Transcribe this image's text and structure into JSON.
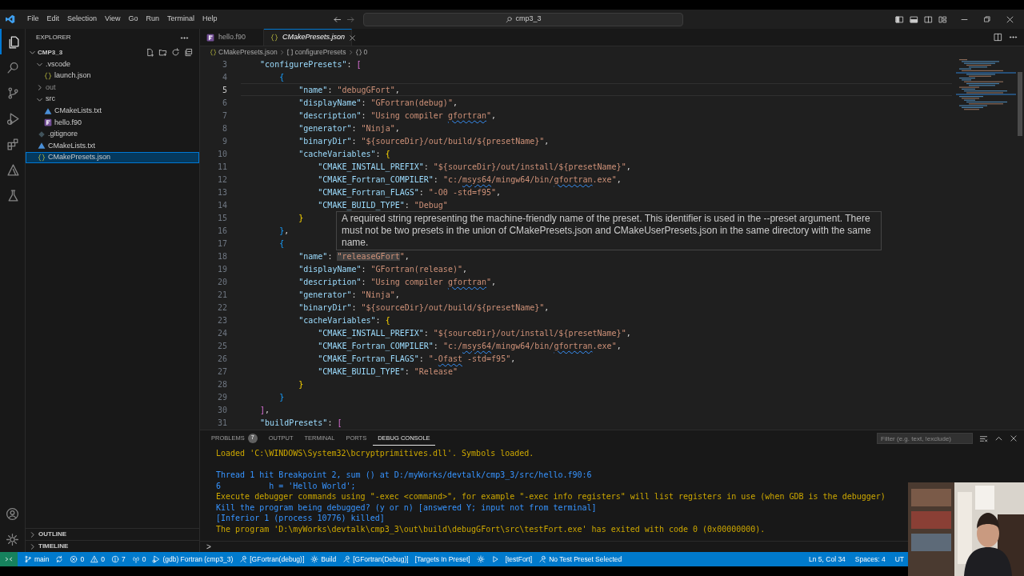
{
  "title_bar": {
    "menu": [
      "File",
      "Edit",
      "Selection",
      "View",
      "Go",
      "Run",
      "Terminal",
      "Help"
    ],
    "command_center": "cmp3_3"
  },
  "activity_bar": [
    {
      "kind": "files",
      "selected": true
    },
    {
      "kind": "search",
      "selected": false
    },
    {
      "kind": "branch",
      "selected": false
    },
    {
      "kind": "rundebug",
      "selected": false
    },
    {
      "kind": "extensions",
      "selected": false
    },
    {
      "kind": "triangle",
      "selected": false
    },
    {
      "kind": "flask",
      "selected": false
    }
  ],
  "activity_bar_bottom": [
    {
      "kind": "account"
    },
    {
      "kind": "gear"
    }
  ],
  "sidebar": {
    "title": "EXPLORER",
    "root": "CMP3_3",
    "tree": [
      {
        "label": ".vscode",
        "kind": "folder",
        "expanded": true,
        "dimmed": false,
        "selected": false,
        "children": [
          {
            "label": "launch.json",
            "kind": "json",
            "dimmed": false,
            "selected": false
          }
        ]
      },
      {
        "label": "out",
        "kind": "folder",
        "expanded": false,
        "dimmed": true,
        "selected": false
      },
      {
        "label": "src",
        "kind": "folder",
        "expanded": true,
        "dimmed": false,
        "selected": false,
        "children": [
          {
            "label": "CMakeLists.txt",
            "kind": "cmake",
            "dimmed": false,
            "selected": false
          },
          {
            "label": "hello.f90",
            "kind": "fortran",
            "dimmed": false,
            "selected": false
          }
        ]
      },
      {
        "label": ".gitignore",
        "kind": "gitignore",
        "dimmed": false,
        "selected": false
      },
      {
        "label": "CMakeLists.txt",
        "kind": "cmake",
        "dimmed": false,
        "selected": false
      },
      {
        "label": "CMakePresets.json",
        "kind": "json",
        "dimmed": false,
        "selected": true
      }
    ],
    "sections": [
      "OUTLINE",
      "TIMELINE"
    ]
  },
  "tabs": [
    {
      "label": "hello.f90",
      "kind": "fortran",
      "selected": false,
      "preview": false
    },
    {
      "label": "CMakePresets.json",
      "kind": "json",
      "selected": true,
      "preview": true
    }
  ],
  "breadcrumb": [
    {
      "kind": "json",
      "text": "CMakePresets.json"
    },
    {
      "kind": "array",
      "text": "configurePresets"
    },
    {
      "kind": "object",
      "text": "0"
    }
  ],
  "code": [
    {
      "number": "3",
      "current": false,
      "tokens": [
        {
          "kind": "key",
          "text": "    \"configurePresets\""
        },
        {
          "kind": "punct",
          "text": ": "
        },
        {
          "kind": "bracket_orchid",
          "text": "["
        }
      ]
    },
    {
      "number": "4",
      "current": false,
      "tokens": [
        {
          "kind": "bracket_blue",
          "text": "        {"
        }
      ]
    },
    {
      "number": "5",
      "current": true,
      "tokens": [
        {
          "kind": "key",
          "text": "            \"name\""
        },
        {
          "kind": "punct",
          "text": ": "
        },
        {
          "kind": "string",
          "text": "\"debugGFort\""
        },
        {
          "kind": "punct",
          "text": ","
        }
      ]
    },
    {
      "number": "6",
      "current": false,
      "tokens": [
        {
          "kind": "key",
          "text": "            \"displayName\""
        },
        {
          "kind": "punct",
          "text": ": "
        },
        {
          "kind": "string",
          "text": "\"GFortran(debug)\""
        },
        {
          "kind": "punct",
          "text": ","
        }
      ]
    },
    {
      "number": "7",
      "current": false,
      "tokens": [
        {
          "kind": "key",
          "text": "            \"description\""
        },
        {
          "kind": "punct",
          "text": ": "
        },
        {
          "kind": "string",
          "text": "\"Using compiler "
        },
        {
          "kind": "squiggle",
          "text": "gfortran"
        },
        {
          "kind": "string",
          "text": "\""
        },
        {
          "kind": "punct",
          "text": ","
        }
      ]
    },
    {
      "number": "8",
      "current": false,
      "tokens": [
        {
          "kind": "key",
          "text": "            \"generator\""
        },
        {
          "kind": "punct",
          "text": ": "
        },
        {
          "kind": "string",
          "text": "\"Ninja\""
        },
        {
          "kind": "punct",
          "text": ","
        }
      ]
    },
    {
      "number": "9",
      "current": false,
      "tokens": [
        {
          "kind": "key",
          "text": "            \"binaryDir\""
        },
        {
          "kind": "punct",
          "text": ": "
        },
        {
          "kind": "string",
          "text": "\"${sourceDir}/out/build/${presetName}\""
        },
        {
          "kind": "punct",
          "text": ","
        }
      ]
    },
    {
      "number": "10",
      "current": false,
      "tokens": [
        {
          "kind": "key",
          "text": "            \"cacheVariables\""
        },
        {
          "kind": "punct",
          "text": ": "
        },
        {
          "kind": "bracket_gold",
          "text": "{"
        }
      ]
    },
    {
      "number": "11",
      "current": false,
      "tokens": [
        {
          "kind": "key",
          "text": "                \"CMAKE_INSTALL_PREFIX\""
        },
        {
          "kind": "punct",
          "text": ": "
        },
        {
          "kind": "string",
          "text": "\"${sourceDir}/out/install/${presetName}\""
        },
        {
          "kind": "punct",
          "text": ","
        }
      ]
    },
    {
      "number": "12",
      "current": false,
      "tokens": [
        {
          "kind": "key",
          "text": "                \"CMAKE_Fortran_COMPILER\""
        },
        {
          "kind": "punct",
          "text": ": "
        },
        {
          "kind": "string",
          "text": "\"c:/"
        },
        {
          "kind": "squiggle",
          "text": "msys64"
        },
        {
          "kind": "string",
          "text": "/mingw64/bin/"
        },
        {
          "kind": "squiggle",
          "text": "gfortran"
        },
        {
          "kind": "string",
          "text": ".exe\""
        },
        {
          "kind": "punct",
          "text": ","
        }
      ]
    },
    {
      "number": "13",
      "current": false,
      "tokens": [
        {
          "kind": "key",
          "text": "                \"CMAKE_Fortran_FLAGS\""
        },
        {
          "kind": "punct",
          "text": ": "
        },
        {
          "kind": "string",
          "text": "\"-O0 -std=f95\""
        },
        {
          "kind": "punct",
          "text": ","
        }
      ]
    },
    {
      "number": "14",
      "current": false,
      "tokens": [
        {
          "kind": "key",
          "text": "                \"CMAKE_BUILD_TYPE\""
        },
        {
          "kind": "punct",
          "text": ": "
        },
        {
          "kind": "string",
          "text": "\"Debug\""
        }
      ]
    },
    {
      "number": "15",
      "current": false,
      "tokens": [
        {
          "kind": "bracket_gold",
          "text": "            }"
        }
      ]
    },
    {
      "number": "16",
      "current": false,
      "tokens": [
        {
          "kind": "bracket_blue",
          "text": "        }"
        },
        {
          "kind": "punct",
          "text": ","
        }
      ]
    },
    {
      "number": "17",
      "current": false,
      "tokens": [
        {
          "kind": "bracket_blue",
          "text": "        {"
        }
      ]
    },
    {
      "number": "18",
      "current": false,
      "tokens": [
        {
          "kind": "key",
          "text": "            \"name\""
        },
        {
          "kind": "punct",
          "text": ": "
        },
        {
          "kind": "highlight",
          "text": "\"releaseGFort"
        },
        {
          "kind": "string",
          "text": "\""
        },
        {
          "kind": "punct",
          "text": ","
        }
      ]
    },
    {
      "number": "19",
      "current": false,
      "tokens": [
        {
          "kind": "key",
          "text": "            \"displayName\""
        },
        {
          "kind": "punct",
          "text": ": "
        },
        {
          "kind": "string",
          "text": "\"GFortran(release)\""
        },
        {
          "kind": "punct",
          "text": ","
        }
      ]
    },
    {
      "number": "20",
      "current": false,
      "tokens": [
        {
          "kind": "key",
          "text": "            \"description\""
        },
        {
          "kind": "punct",
          "text": ": "
        },
        {
          "kind": "string",
          "text": "\"Using compiler "
        },
        {
          "kind": "squiggle",
          "text": "gfortran"
        },
        {
          "kind": "string",
          "text": "\""
        },
        {
          "kind": "punct",
          "text": ","
        }
      ]
    },
    {
      "number": "21",
      "current": false,
      "tokens": [
        {
          "kind": "key",
          "text": "            \"generator\""
        },
        {
          "kind": "punct",
          "text": ": "
        },
        {
          "kind": "string",
          "text": "\"Ninja\""
        },
        {
          "kind": "punct",
          "text": ","
        }
      ]
    },
    {
      "number": "22",
      "current": false,
      "tokens": [
        {
          "kind": "key",
          "text": "            \"binaryDir\""
        },
        {
          "kind": "punct",
          "text": ": "
        },
        {
          "kind": "string",
          "text": "\"${sourceDir}/out/build/${presetName}\""
        },
        {
          "kind": "punct",
          "text": ","
        }
      ]
    },
    {
      "number": "23",
      "current": false,
      "tokens": [
        {
          "kind": "key",
          "text": "            \"cacheVariables\""
        },
        {
          "kind": "punct",
          "text": ": "
        },
        {
          "kind": "bracket_gold",
          "text": "{"
        }
      ]
    },
    {
      "number": "24",
      "current": false,
      "tokens": [
        {
          "kind": "key",
          "text": "                \"CMAKE_INSTALL_PREFIX\""
        },
        {
          "kind": "punct",
          "text": ": "
        },
        {
          "kind": "string",
          "text": "\"${sourceDir}/out/install/${presetName}\""
        },
        {
          "kind": "punct",
          "text": ","
        }
      ]
    },
    {
      "number": "25",
      "current": false,
      "tokens": [
        {
          "kind": "key",
          "text": "                \"CMAKE_Fortran_COMPILER\""
        },
        {
          "kind": "punct",
          "text": ": "
        },
        {
          "kind": "string",
          "text": "\"c:/"
        },
        {
          "kind": "squiggle",
          "text": "msys64"
        },
        {
          "kind": "string",
          "text": "/mingw64/bin/"
        },
        {
          "kind": "squiggle",
          "text": "gfortran"
        },
        {
          "kind": "string",
          "text": ".exe\""
        },
        {
          "kind": "punct",
          "text": ","
        }
      ]
    },
    {
      "number": "26",
      "current": false,
      "tokens": [
        {
          "kind": "key",
          "text": "                \"CMAKE_Fortran_FLAGS\""
        },
        {
          "kind": "punct",
          "text": ": "
        },
        {
          "kind": "string",
          "text": "\"-"
        },
        {
          "kind": "squiggle",
          "text": "Ofast"
        },
        {
          "kind": "string",
          "text": " -std=f95\""
        },
        {
          "kind": "punct",
          "text": ","
        }
      ]
    },
    {
      "number": "27",
      "current": false,
      "tokens": [
        {
          "kind": "key",
          "text": "                \"CMAKE_BUILD_TYPE\""
        },
        {
          "kind": "punct",
          "text": ": "
        },
        {
          "kind": "string",
          "text": "\"Release\""
        }
      ]
    },
    {
      "number": "28",
      "current": false,
      "tokens": [
        {
          "kind": "bracket_gold",
          "text": "            }"
        }
      ]
    },
    {
      "number": "29",
      "current": false,
      "tokens": [
        {
          "kind": "bracket_blue",
          "text": "        }"
        }
      ]
    },
    {
      "number": "30",
      "current": false,
      "tokens": [
        {
          "kind": "bracket_orchid",
          "text": "    ]"
        },
        {
          "kind": "punct",
          "text": ","
        }
      ]
    },
    {
      "number": "31",
      "current": false,
      "tokens": [
        {
          "kind": "key",
          "text": "    \"buildPresets\""
        },
        {
          "kind": "punct",
          "text": ": "
        },
        {
          "kind": "bracket_orchid",
          "text": "["
        }
      ]
    }
  ],
  "hover_tooltip": "A required string representing the machine-friendly name of the preset. This identifier is used in the --preset argument. There must not be two presets in the union of CMakePresets.json and CMakeUserPresets.json in the same directory with the same name.",
  "panel": {
    "tabs": [
      {
        "label": "PROBLEMS",
        "badge": "7",
        "selected": false
      },
      {
        "label": "OUTPUT",
        "selected": false
      },
      {
        "label": "TERMINAL",
        "selected": false
      },
      {
        "label": "PORTS",
        "selected": false
      },
      {
        "label": "DEBUG CONSOLE",
        "selected": true
      }
    ],
    "filter": {
      "placeholder": "Filter (e.g. text, !exclude)"
    },
    "console": [
      {
        "text": "Loaded 'C:\\WINDOWS\\System32\\bcryptprimitives.dll'. Symbols loaded.",
        "color": "#cca700",
        "blank_before": false
      },
      {
        "text": "Thread 1 hit Breakpoint 2, sum () at D:/myWorks/devtalk/cmp3_3/src/hello.f90:6",
        "color": "#3794ff",
        "blank_before": true
      },
      {
        "text": "6          h = 'Hello World';",
        "color": "#3794ff",
        "blank_before": false
      },
      {
        "text": "Execute debugger commands using \"-exec <command>\", for example \"-exec info registers\" will list registers in use (when GDB is the debugger)",
        "color": "#cca700",
        "blank_before": false
      },
      {
        "text": "Kill the program being debugged? (y or n) [answered Y; input not from terminal]",
        "color": "#3794ff",
        "blank_before": false
      },
      {
        "text": "[Inferior 1 (process 10776) killed]",
        "color": "#3794ff",
        "blank_before": false
      },
      {
        "text": "The program 'D:\\myWorks\\devtalk\\cmp3_3\\out\\build\\debugGFort\\src\\testFort.exe' has exited with code 0 (0x00000000).",
        "color": "#cca700",
        "blank_before": false
      }
    ],
    "prompt": ">"
  },
  "status_bar": {
    "left": [
      {
        "kind": "remote"
      },
      {
        "kind": "branch",
        "text": "main"
      },
      {
        "kind": "sync"
      },
      {
        "kind": "error",
        "text": "0"
      },
      {
        "kind": "warning",
        "text": "0"
      },
      {
        "kind": "info",
        "text": "7"
      },
      {
        "kind": "plug",
        "text": "0"
      },
      {
        "kind": "rundebug",
        "text": "(gdb) Fortran (cmp3_3)"
      },
      {
        "kind": "tools",
        "text": "[GFortran(debug)]"
      },
      {
        "kind": "gear",
        "text": "Build"
      },
      {
        "kind": "tools",
        "text": "[GFortran(Debug)]"
      },
      {
        "kind": "plain",
        "text": "[Targets In Preset]"
      },
      {
        "kind": "gear"
      },
      {
        "kind": "play"
      },
      {
        "kind": "plain",
        "text": "[testFort]"
      },
      {
        "kind": "tools",
        "text": "No Test Preset Selected"
      }
    ],
    "right": [
      "Ln 5, Col 34",
      "Spaces: 4",
      "UT"
    ]
  }
}
